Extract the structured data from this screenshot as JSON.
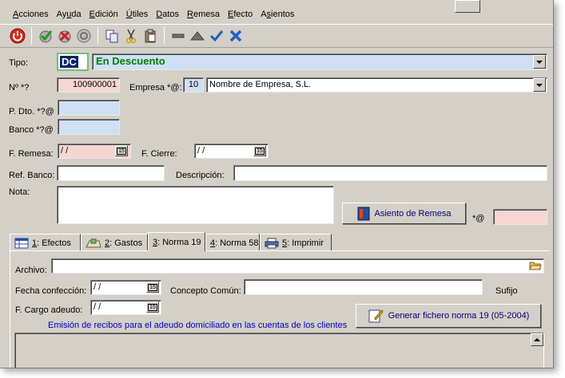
{
  "menu": [
    {
      "pre": "",
      "ul": "A",
      "post": "cciones"
    },
    {
      "pre": "Ay",
      "ul": "u",
      "post": "da"
    },
    {
      "pre": "",
      "ul": "E",
      "post": "dición"
    },
    {
      "pre": "",
      "ul": "Ú",
      "post": "tiles"
    },
    {
      "pre": "",
      "ul": "D",
      "post": "atos"
    },
    {
      "pre": "",
      "ul": "R",
      "post": "emesa"
    },
    {
      "pre": "",
      "ul": "E",
      "post": "fecto"
    },
    {
      "pre": "A",
      "ul": "s",
      "post": "ientos"
    }
  ],
  "form": {
    "tipo_label": "Tipo:",
    "tipo_code": "DC",
    "tipo_value": "En Descuento",
    "numero_label": "Nº *?",
    "numero_value": "100900001",
    "empresa_label": "Empresa *@:",
    "empresa_code": "10",
    "empresa_value": "Nombre de Empresa, S.L.",
    "pdto_label": "P. Dto. *?@",
    "banco_label": "Banco *?@",
    "fremesa_label": "F. Remesa:",
    "fremesa_value": "/ /",
    "fcierre_label": "F. Cierre:",
    "fcierre_value": "/ /",
    "refbanco_label": "Ref. Banco:",
    "descripcion_label": "Descripción:",
    "nota_label": "Nota:",
    "asiento_button": "Asiento de Remesa",
    "asiento_suffix": "*@"
  },
  "tabs": [
    {
      "ul": "1",
      "rest": ": Efectos"
    },
    {
      "ul": "2",
      "rest": ": Gastos"
    },
    {
      "ul": "3",
      "rest": ": Norma 19"
    },
    {
      "ul": "4",
      "rest": ": Norma 58"
    },
    {
      "ul": "5",
      "rest": ": Imprimir"
    }
  ],
  "norma19": {
    "archivo_label": "Archivo:",
    "fecha_label": "Fecha confección:",
    "fecha_value": "/ /",
    "concepto_label": "Concepto Común:",
    "sufijo_label": "Sufijo",
    "fcargo_label": "F. Cargo adeudo:",
    "fcargo_value": "/ /",
    "generar_button": "Generar fichero norma 19 (05-2004)",
    "emision_note": "Emisión de recibos para el adeudo domiciliado en las cuentas de los clientes"
  },
  "colors": {
    "accent_green": "#008000",
    "field_blue": "#cfe0f5",
    "field_pink": "#f6d6d2",
    "link_blue": "#0000c0"
  }
}
